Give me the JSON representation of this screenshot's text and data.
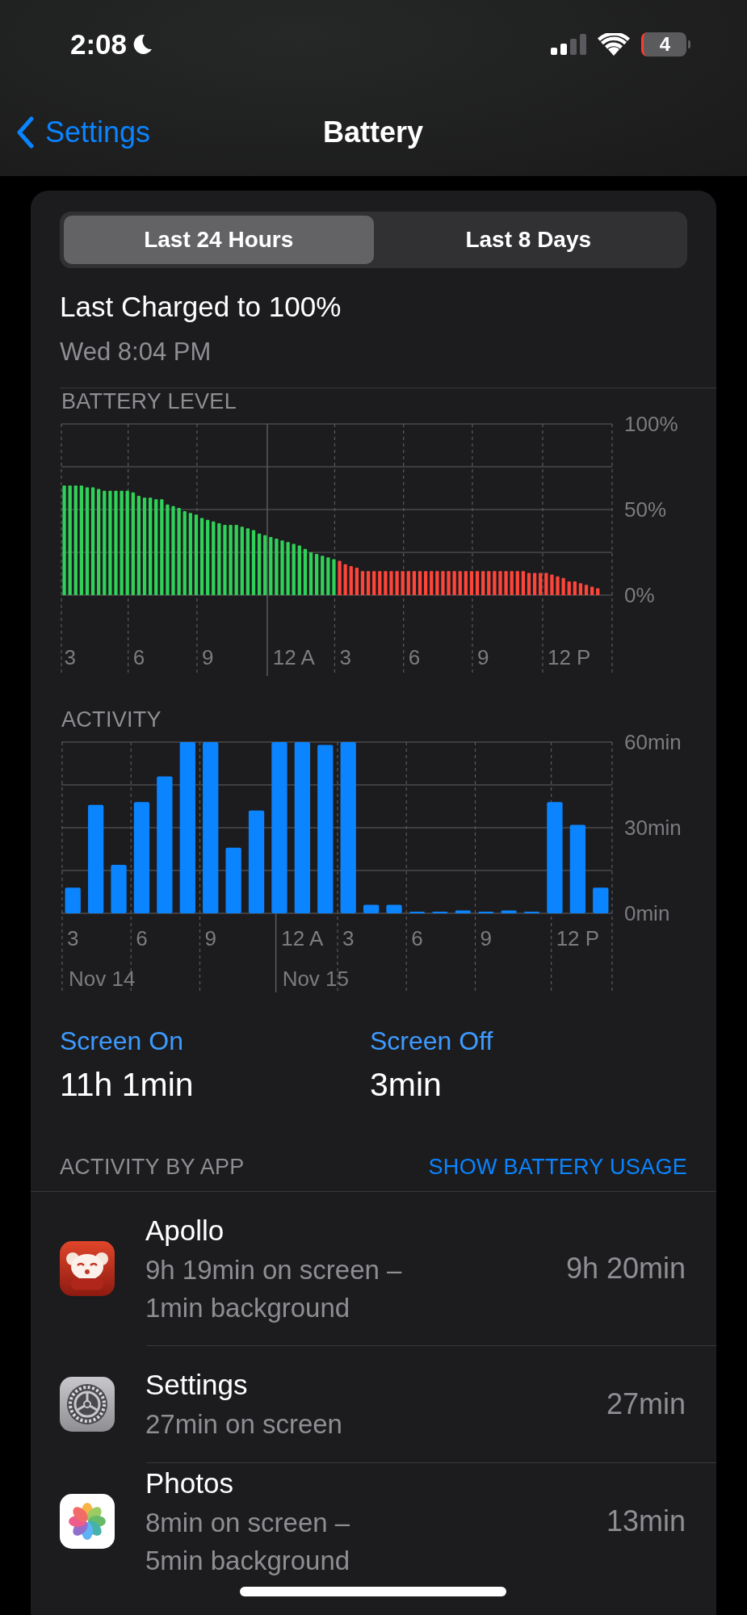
{
  "status_bar": {
    "time": "2:08",
    "battery": "4"
  },
  "nav": {
    "back": "Settings",
    "title": "Battery"
  },
  "segments": [
    {
      "label": "Last 24 Hours",
      "selected": true
    },
    {
      "label": "Last 8 Days",
      "selected": false
    }
  ],
  "last_charged": {
    "title": "Last Charged to 100%",
    "time": "Wed 8:04 PM"
  },
  "charts": [
    {
      "heading": "BATTERY LEVEL",
      "chart_data": {
        "type": "bar",
        "categories": [
          null,
          "3",
          null,
          null,
          null,
          null,
          null,
          null,
          null,
          null,
          null,
          null,
          null,
          "6",
          null,
          null,
          null,
          null,
          null,
          null,
          null,
          null,
          null,
          null,
          null,
          "9",
          null,
          null,
          null,
          null,
          null,
          null,
          null,
          null,
          null,
          null,
          null,
          null,
          null,
          null,
          "12 A",
          null,
          null,
          null,
          null,
          null,
          null,
          null,
          null,
          "3",
          null,
          null,
          null,
          null,
          null,
          null,
          null,
          null,
          null,
          null,
          null,
          "6",
          null,
          null,
          null,
          null,
          null,
          null,
          null,
          null,
          null,
          null,
          null,
          "9",
          null,
          null,
          null,
          null,
          null,
          null,
          null,
          null,
          null,
          null,
          null,
          null,
          null,
          null,
          "12 P",
          null,
          null,
          null,
          null,
          null,
          null,
          null
        ],
        "series": [
          {
            "color": "#30d158",
            "values": [
              64,
              64,
              64,
              64,
              63,
              63,
              62,
              61,
              61,
              61,
              61,
              61,
              60,
              58,
              57,
              57,
              56,
              56,
              53,
              52,
              51,
              49,
              48,
              47,
              45,
              44,
              43,
              42,
              41,
              41,
              41,
              40,
              39,
              38,
              36,
              35,
              34,
              33,
              32,
              31,
              30,
              29,
              27,
              25,
              24,
              23,
              22,
              21,
              null,
              null,
              null,
              null,
              null,
              null,
              null,
              null,
              null,
              null,
              null,
              null,
              null,
              null,
              null,
              null,
              null,
              null,
              null,
              null,
              null,
              null,
              null,
              null,
              null,
              null,
              null,
              null,
              null,
              null,
              null,
              null,
              null,
              null,
              null,
              null,
              null,
              null,
              null,
              null,
              null,
              null,
              null,
              null,
              null,
              null,
              null,
              null
            ]
          },
          {
            "color": "#ff453a",
            "values": [
              null,
              null,
              null,
              null,
              null,
              null,
              null,
              null,
              null,
              null,
              null,
              null,
              null,
              null,
              null,
              null,
              null,
              null,
              null,
              null,
              null,
              null,
              null,
              null,
              null,
              null,
              null,
              null,
              null,
              null,
              null,
              null,
              null,
              null,
              null,
              null,
              null,
              null,
              null,
              null,
              null,
              null,
              null,
              null,
              null,
              null,
              null,
              null,
              20,
              18,
              17,
              16,
              14,
              14,
              14,
              14,
              14,
              14,
              14,
              14,
              14,
              14,
              14,
              14,
              14,
              14,
              14,
              14,
              14,
              14,
              14,
              14,
              14,
              14,
              14,
              14,
              14,
              14,
              14,
              14,
              14,
              13,
              13,
              13,
              13,
              12,
              11,
              10,
              8,
              8,
              7,
              6,
              5,
              4,
              null,
              null
            ]
          }
        ],
        "ylim": [
          0,
          100
        ],
        "yticks": [
          {
            "value": 0,
            "label": "0%"
          },
          {
            "value": 50,
            "label": "50%"
          },
          {
            "value": 100,
            "label": "100%"
          }
        ]
      }
    },
    {
      "heading": "ACTIVITY",
      "dates": [
        {
          "label": "Nov 14"
        },
        {
          "label": "Nov 15"
        }
      ],
      "chart_data": {
        "type": "bar",
        "categories": [
          "3",
          null,
          null,
          "6",
          null,
          null,
          "9",
          null,
          null,
          null,
          "12 A",
          null,
          "3",
          null,
          null,
          "6",
          null,
          null,
          "9",
          null,
          null,
          null,
          "12 P",
          null
        ],
        "series": [
          {
            "color": "#0a84ff",
            "values": [
              9,
              38,
              17,
              39,
              48,
              60,
              60,
              23,
              36,
              60,
              60,
              59,
              60,
              3,
              3,
              0,
              0,
              1,
              0,
              1,
              0,
              39,
              31,
              9
            ]
          }
        ],
        "ylim": [
          0,
          60
        ],
        "yticks": [
          {
            "value": 0,
            "label": "0min"
          },
          {
            "value": 30,
            "label": "30min"
          },
          {
            "value": 60,
            "label": "60min"
          }
        ]
      }
    }
  ],
  "screen_time": [
    {
      "label": "Screen On",
      "value": "11h 1min"
    },
    {
      "label": "Screen Off",
      "value": "3min"
    }
  ],
  "activity_by_app": {
    "heading": "ACTIVITY BY APP",
    "action": "SHOW BATTERY USAGE",
    "apps": [
      {
        "kind": "apollo",
        "name": "Apollo",
        "detail": [
          "9h 19min on screen –",
          "1min background"
        ],
        "total": "9h 20min"
      },
      {
        "kind": "settings",
        "name": "Settings",
        "detail": [
          "27min on screen"
        ],
        "total": "27min"
      },
      {
        "kind": "photos",
        "name": "Photos",
        "detail": [
          "8min on screen –",
          "5min background"
        ],
        "total": "13min"
      }
    ]
  }
}
